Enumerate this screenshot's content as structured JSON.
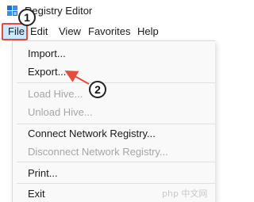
{
  "window": {
    "title": "Registry Editor",
    "icon": "registry-editor-icon"
  },
  "menubar": {
    "items": [
      {
        "label": "File",
        "active": true
      },
      {
        "label": "Edit"
      },
      {
        "label": "View"
      },
      {
        "label": "Favorites"
      },
      {
        "label": "Help"
      }
    ]
  },
  "file_menu": {
    "items": [
      {
        "label": "Import...",
        "enabled": true
      },
      {
        "label": "Export...",
        "enabled": true
      },
      {
        "label": "Load Hive...",
        "enabled": false
      },
      {
        "label": "Unload Hive...",
        "enabled": false
      },
      {
        "label": "Connect Network Registry...",
        "enabled": true
      },
      {
        "label": "Disconnect Network Registry...",
        "enabled": false
      },
      {
        "label": "Print...",
        "enabled": true
      },
      {
        "label": "Exit",
        "enabled": true
      }
    ]
  },
  "annotations": {
    "step1": "1",
    "step2": "2",
    "highlight_color": "#e84a3b"
  },
  "watermark": "php 中文网"
}
